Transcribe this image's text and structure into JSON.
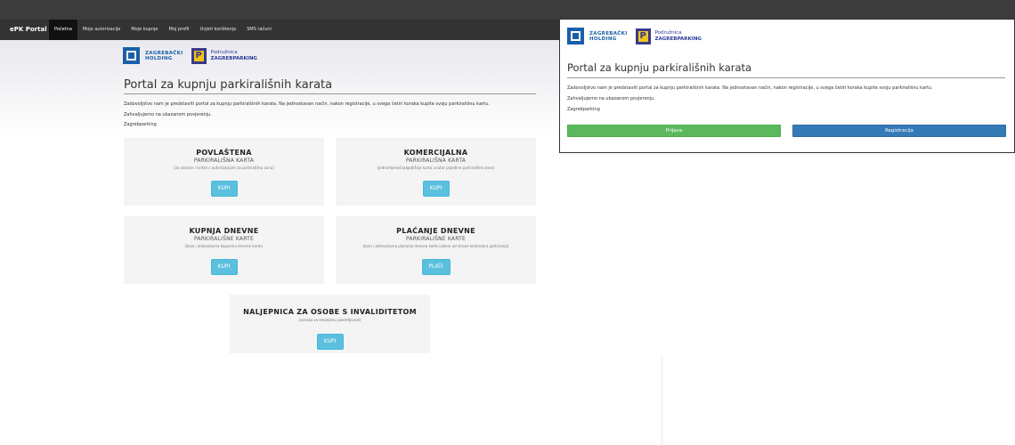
{
  "navbar": {
    "brand": "ePK Portal",
    "items": [
      {
        "label": "Početna",
        "active": true
      },
      {
        "label": "Moje autorizacije",
        "active": false
      },
      {
        "label": "Moje kupnje",
        "active": false
      },
      {
        "label": "Moj profil",
        "active": false
      },
      {
        "label": "Uvjeti korištenja",
        "active": false
      },
      {
        "label": "SMS računi",
        "active": false
      }
    ]
  },
  "logos": {
    "holding_line1": "ZAGREBAČKI",
    "holding_line2": "HOLDING",
    "parking_line1": "Podružnica",
    "parking_line2": "ZAGREBPARKING"
  },
  "main": {
    "title": "Portal za kupnju parkirališnih karata",
    "paragraphs": [
      "Zadovoljstvo nam je predstaviti portal za kupnju parkirališnih karata. Na jednostavan način, nakon registracije, u svega četiri koraka kupite svoju parkirališnu kartu.",
      "Zahvaljujemo na ukazanom povjerenju.",
      "Zagrebparking"
    ],
    "cards": [
      {
        "title": "POVLAŠTENA",
        "subtitle": "PARKIRALIŠNA KARTA",
        "note": "(za stanare i tvrtke s autorizacijom za parkirališnu zonu)",
        "button": "KUPI"
      },
      {
        "title": "KOMERCIJALNA",
        "subtitle": "PARKIRALIŠNA KARTA",
        "note": "(jednomjesečna/godišnja karta unutar pojedine parkirališne zone)",
        "button": "KUPI"
      },
      {
        "title": "KUPNJA DNEVNE",
        "subtitle": "PARKIRALIŠNE KARTE",
        "note": "(brza i jednostavna kupovina dnevne karte)",
        "button": "KUPI"
      },
      {
        "title": "PLAĆANJE DNEVNE",
        "subtitle": "PARKIRALIŠNE KARTE",
        "note": "(brzo i jednostavno plaćanje dnevne karte izdane od strane kontrolora parkiranja)",
        "button": "PLATI"
      },
      {
        "title": "NALJEPNICA ZA OSOBE S INVALIDITETOM",
        "subtitle": "",
        "note": "(oznaka za smanjenu pokretljivost)",
        "button": "KUPI"
      }
    ]
  },
  "panel": {
    "title": "Portal za kupnju parkirališnih karata",
    "paragraphs": [
      "Zadovoljstvo nam je predstaviti portal za kupnju parkirališnih karata. Na jednostavan način, nakon registracije, u svega četiri koraka kupite svoju parkirališnu kartu.",
      "Zahvaljujemo na ukazanom povjerenju.",
      "Zagrebparking"
    ],
    "login_label": "Prijava",
    "register_label": "Registracija"
  },
  "colors": {
    "navbar": "#333333",
    "card_button": "#5bc0de",
    "login_button": "#5cb85c",
    "register_button": "#337ab7",
    "logo_blue": "#1a5fa8"
  }
}
